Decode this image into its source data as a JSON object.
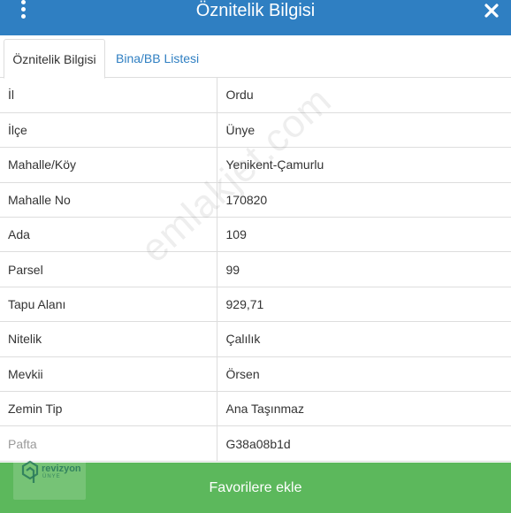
{
  "header": {
    "title": "Öznitelik Bilgisi",
    "menu_icon": "vertical-dots-icon",
    "close_icon": "close-icon",
    "background": "#2f7fc2"
  },
  "tabs": [
    {
      "label": "Öznitelik Bilgisi",
      "active": true
    },
    {
      "label": "Bina/BB Listesi",
      "active": false
    }
  ],
  "attributes": [
    {
      "key": "İl",
      "value": "Ordu"
    },
    {
      "key": "İlçe",
      "value": "Ünye"
    },
    {
      "key": "Mahalle/Köy",
      "value": "Yenikent-Çamurlu"
    },
    {
      "key": "Mahalle No",
      "value": "170820"
    },
    {
      "key": "Ada",
      "value": "109"
    },
    {
      "key": "Parsel",
      "value": "99"
    },
    {
      "key": "Tapu Alanı",
      "value": "929,71"
    },
    {
      "key": "Nitelik",
      "value": "Çalılık"
    },
    {
      "key": "Mevkii",
      "value": "Örsen"
    },
    {
      "key": "Zemin Tip",
      "value": "Ana Taşınmaz"
    },
    {
      "key": "Pafta",
      "value": "G38a08b1d"
    }
  ],
  "watermark": {
    "text": "emlakjet.com"
  },
  "logo": {
    "name": "revizyon",
    "sub": "ÜNYE"
  },
  "footer": {
    "favorite_label": "Favorilere ekle",
    "background": "#5cb85c"
  }
}
